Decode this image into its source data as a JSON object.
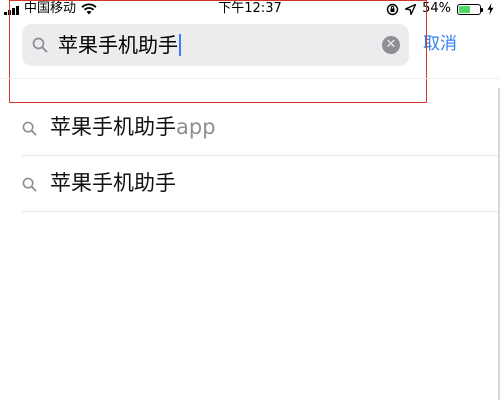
{
  "status_bar": {
    "carrier": "中国移动",
    "time": "下午12:37",
    "battery_percent": "54%",
    "battery_level": 0.54,
    "icons": [
      "signal-bars-icon",
      "wifi-icon",
      "orientation-lock-icon",
      "location-arrow-icon",
      "battery-icon",
      "charging-bolt-icon"
    ]
  },
  "search": {
    "query": "苹果手机助手",
    "cancel_label": "取消",
    "icons": [
      "magnifier-icon",
      "clear-icon"
    ]
  },
  "suggestions": [
    {
      "match": "苹果手机助手",
      "completion": "app"
    },
    {
      "match": "苹果手机助手",
      "completion": ""
    }
  ],
  "colors": {
    "accent": "#2f80ed",
    "highlight_box": "#d2372d",
    "battery": "#4cd964"
  }
}
